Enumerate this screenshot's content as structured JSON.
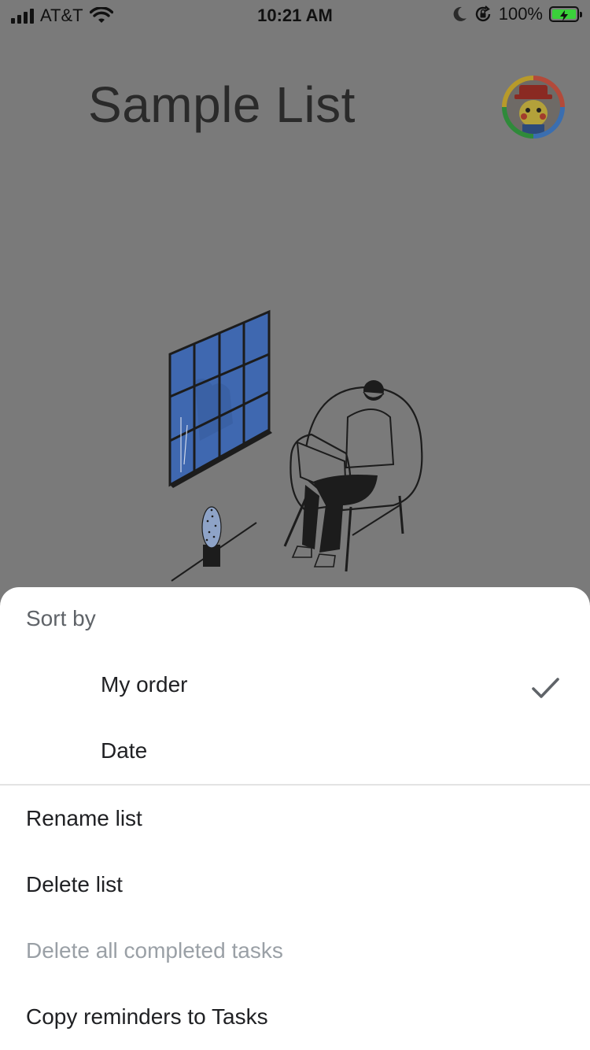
{
  "status_bar": {
    "carrier": "AT&T",
    "time": "10:21 AM",
    "battery_percent": "100%",
    "icons": [
      "signal-icon",
      "wifi-icon",
      "moon-icon",
      "orientation-lock-icon",
      "battery-charging-icon"
    ]
  },
  "header": {
    "title": "Sample List",
    "avatar_icon": "account-avatar-icon"
  },
  "illustration": {
    "icon": "empty-list-illustration",
    "colors": {
      "window_fill": "#3f68b0",
      "line": "#1c1c1c"
    }
  },
  "sheet": {
    "sort_heading": "Sort by",
    "sort_options": [
      {
        "label": "My order",
        "selected": true
      },
      {
        "label": "Date",
        "selected": false
      }
    ],
    "menu_items": [
      {
        "label": "Rename list",
        "enabled": true
      },
      {
        "label": "Delete list",
        "enabled": true
      },
      {
        "label": "Delete all completed tasks",
        "enabled": false
      },
      {
        "label": "Copy reminders to Tasks",
        "enabled": true
      }
    ]
  },
  "colors": {
    "scrim_background": "#7a7a7a",
    "sheet_background": "#ffffff",
    "disabled_text": "#9aa0a6",
    "battery_fill": "#3ad13a"
  }
}
